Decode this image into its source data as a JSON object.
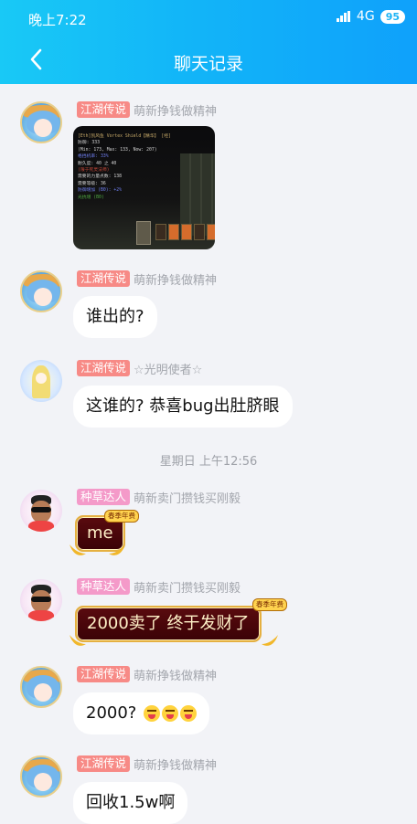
{
  "status_bar": {
    "time": "晚上7:22",
    "network": "4G",
    "battery": "95"
  },
  "header": {
    "title": "聊天记录"
  },
  "image_message": {
    "lines": [
      {
        "text": "[Eth]凯风鱼 Vortex Shield【精华】 [经]",
        "style": "gold"
      },
      {
        "text": "防御: 333",
        "style": "white"
      },
      {
        "text": "(Min: 173, Max: 133, Now: 207)",
        "style": "white"
      },
      {
        "text": "格挡机率: 33%",
        "style": "blue"
      },
      {
        "text": "耐久度: 40 之 40",
        "style": "white"
      },
      {
        "text": "(限于死灵法师)",
        "style": "red"
      },
      {
        "text": "需要的力量点数: 138",
        "style": "white"
      },
      {
        "text": "需要等级: 36",
        "style": "white"
      },
      {
        "text": "防御增加 (B0): +2%",
        "style": "blue"
      },
      {
        "text": "光抗增 (B0)",
        "style": "green"
      }
    ]
  },
  "messages": [
    {
      "badge": "江湖传说",
      "nick": "萌新挣钱做精神",
      "text": "谁出的?"
    },
    {
      "badge": "江湖传说",
      "nick": "☆光明使者☆",
      "text": "这谁的? 恭喜bug出肚脐眼"
    }
  ],
  "separator": "星期日 上午12:56",
  "fancy_messages": [
    {
      "badge": "种草达人",
      "nick": "萌新卖门攒钱买刚毅",
      "text": "me",
      "crown": "春季年费"
    },
    {
      "badge": "种草达人",
      "nick": "萌新卖门攒钱买刚毅",
      "text": "2000卖了  终于发财了",
      "crown": "春季年费"
    }
  ],
  "late_messages": [
    {
      "badge": "江湖传说",
      "nick": "萌新挣钱做精神",
      "text": "2000?"
    },
    {
      "badge": "江湖传说",
      "nick": "萌新挣钱做精神",
      "text": "回收1.5w啊"
    }
  ],
  "first_meta": {
    "badge": "江湖传说",
    "nick": "萌新挣钱做精神"
  },
  "colors": {
    "header_start": "#19c9f6",
    "header_end": "#0fa1fb",
    "badge_red": "#f78a86",
    "badge_pink": "#f49ac9"
  }
}
